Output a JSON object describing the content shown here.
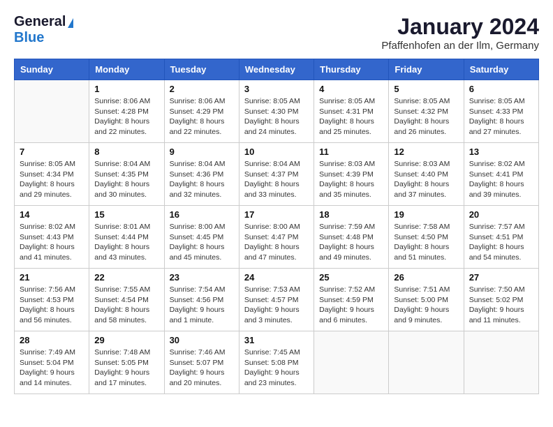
{
  "header": {
    "logo_general": "General",
    "logo_blue": "Blue",
    "title": "January 2024",
    "subtitle": "Pfaffenhofen an der Ilm, Germany"
  },
  "columns": [
    "Sunday",
    "Monday",
    "Tuesday",
    "Wednesday",
    "Thursday",
    "Friday",
    "Saturday"
  ],
  "weeks": [
    [
      {
        "day": "",
        "info": ""
      },
      {
        "day": "1",
        "info": "Sunrise: 8:06 AM\nSunset: 4:28 PM\nDaylight: 8 hours\nand 22 minutes."
      },
      {
        "day": "2",
        "info": "Sunrise: 8:06 AM\nSunset: 4:29 PM\nDaylight: 8 hours\nand 22 minutes."
      },
      {
        "day": "3",
        "info": "Sunrise: 8:05 AM\nSunset: 4:30 PM\nDaylight: 8 hours\nand 24 minutes."
      },
      {
        "day": "4",
        "info": "Sunrise: 8:05 AM\nSunset: 4:31 PM\nDaylight: 8 hours\nand 25 minutes."
      },
      {
        "day": "5",
        "info": "Sunrise: 8:05 AM\nSunset: 4:32 PM\nDaylight: 8 hours\nand 26 minutes."
      },
      {
        "day": "6",
        "info": "Sunrise: 8:05 AM\nSunset: 4:33 PM\nDaylight: 8 hours\nand 27 minutes."
      }
    ],
    [
      {
        "day": "7",
        "info": "Sunrise: 8:05 AM\nSunset: 4:34 PM\nDaylight: 8 hours\nand 29 minutes."
      },
      {
        "day": "8",
        "info": "Sunrise: 8:04 AM\nSunset: 4:35 PM\nDaylight: 8 hours\nand 30 minutes."
      },
      {
        "day": "9",
        "info": "Sunrise: 8:04 AM\nSunset: 4:36 PM\nDaylight: 8 hours\nand 32 minutes."
      },
      {
        "day": "10",
        "info": "Sunrise: 8:04 AM\nSunset: 4:37 PM\nDaylight: 8 hours\nand 33 minutes."
      },
      {
        "day": "11",
        "info": "Sunrise: 8:03 AM\nSunset: 4:39 PM\nDaylight: 8 hours\nand 35 minutes."
      },
      {
        "day": "12",
        "info": "Sunrise: 8:03 AM\nSunset: 4:40 PM\nDaylight: 8 hours\nand 37 minutes."
      },
      {
        "day": "13",
        "info": "Sunrise: 8:02 AM\nSunset: 4:41 PM\nDaylight: 8 hours\nand 39 minutes."
      }
    ],
    [
      {
        "day": "14",
        "info": "Sunrise: 8:02 AM\nSunset: 4:43 PM\nDaylight: 8 hours\nand 41 minutes."
      },
      {
        "day": "15",
        "info": "Sunrise: 8:01 AM\nSunset: 4:44 PM\nDaylight: 8 hours\nand 43 minutes."
      },
      {
        "day": "16",
        "info": "Sunrise: 8:00 AM\nSunset: 4:45 PM\nDaylight: 8 hours\nand 45 minutes."
      },
      {
        "day": "17",
        "info": "Sunrise: 8:00 AM\nSunset: 4:47 PM\nDaylight: 8 hours\nand 47 minutes."
      },
      {
        "day": "18",
        "info": "Sunrise: 7:59 AM\nSunset: 4:48 PM\nDaylight: 8 hours\nand 49 minutes."
      },
      {
        "day": "19",
        "info": "Sunrise: 7:58 AM\nSunset: 4:50 PM\nDaylight: 8 hours\nand 51 minutes."
      },
      {
        "day": "20",
        "info": "Sunrise: 7:57 AM\nSunset: 4:51 PM\nDaylight: 8 hours\nand 54 minutes."
      }
    ],
    [
      {
        "day": "21",
        "info": "Sunrise: 7:56 AM\nSunset: 4:53 PM\nDaylight: 8 hours\nand 56 minutes."
      },
      {
        "day": "22",
        "info": "Sunrise: 7:55 AM\nSunset: 4:54 PM\nDaylight: 8 hours\nand 58 minutes."
      },
      {
        "day": "23",
        "info": "Sunrise: 7:54 AM\nSunset: 4:56 PM\nDaylight: 9 hours\nand 1 minute."
      },
      {
        "day": "24",
        "info": "Sunrise: 7:53 AM\nSunset: 4:57 PM\nDaylight: 9 hours\nand 3 minutes."
      },
      {
        "day": "25",
        "info": "Sunrise: 7:52 AM\nSunset: 4:59 PM\nDaylight: 9 hours\nand 6 minutes."
      },
      {
        "day": "26",
        "info": "Sunrise: 7:51 AM\nSunset: 5:00 PM\nDaylight: 9 hours\nand 9 minutes."
      },
      {
        "day": "27",
        "info": "Sunrise: 7:50 AM\nSunset: 5:02 PM\nDaylight: 9 hours\nand 11 minutes."
      }
    ],
    [
      {
        "day": "28",
        "info": "Sunrise: 7:49 AM\nSunset: 5:04 PM\nDaylight: 9 hours\nand 14 minutes."
      },
      {
        "day": "29",
        "info": "Sunrise: 7:48 AM\nSunset: 5:05 PM\nDaylight: 9 hours\nand 17 minutes."
      },
      {
        "day": "30",
        "info": "Sunrise: 7:46 AM\nSunset: 5:07 PM\nDaylight: 9 hours\nand 20 minutes."
      },
      {
        "day": "31",
        "info": "Sunrise: 7:45 AM\nSunset: 5:08 PM\nDaylight: 9 hours\nand 23 minutes."
      },
      {
        "day": "",
        "info": ""
      },
      {
        "day": "",
        "info": ""
      },
      {
        "day": "",
        "info": ""
      }
    ]
  ]
}
